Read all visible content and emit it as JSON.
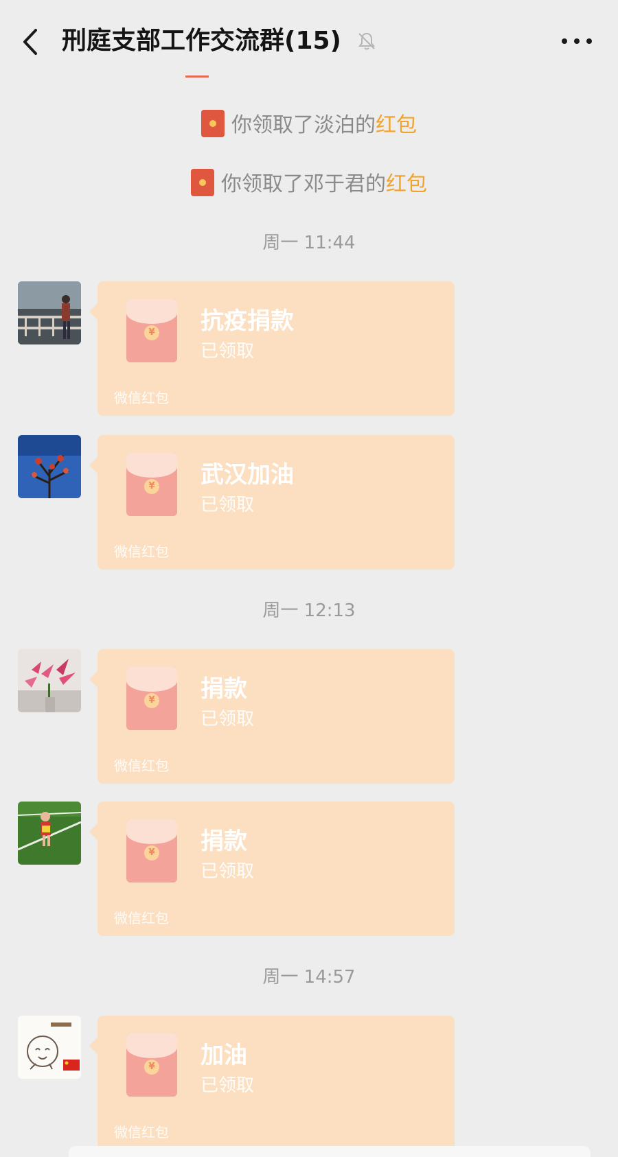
{
  "header": {
    "title": "刑庭支部工作交流群(15)",
    "back_icon": "chevron-left-icon",
    "mute_icon": "bell-off-icon",
    "more_icon": "more-dots-icon"
  },
  "system_messages": [
    {
      "prefix": "你领取了淡泊的",
      "link": "红包"
    },
    {
      "prefix": "你领取了邓于君的",
      "link": "红包"
    }
  ],
  "timestamps": [
    "周一 11:44",
    "周一 12:13",
    "周一 14:57"
  ],
  "messages": [
    {
      "title": "抗疫捐款",
      "status": "已领取",
      "footer": "微信红包",
      "avatar": "avatar-person-railing"
    },
    {
      "title": "武汉加油",
      "status": "已领取",
      "footer": "微信红包",
      "avatar": "avatar-tree-blue-sky"
    },
    {
      "title": "捐款",
      "status": "已领取",
      "footer": "微信红包",
      "avatar": "avatar-lily-flowers"
    },
    {
      "title": "捐款",
      "status": "已领取",
      "footer": "微信红包",
      "avatar": "avatar-child-grass"
    },
    {
      "title": "加油",
      "status": "已领取",
      "footer": "微信红包",
      "avatar": "avatar-cartoon-flag"
    }
  ],
  "colors": {
    "background": "#ededed",
    "bubble": "#fbdfc0",
    "envelope": "#f3a39a",
    "link": "#f1a32e",
    "red_packet_icon": "#e0573f"
  }
}
